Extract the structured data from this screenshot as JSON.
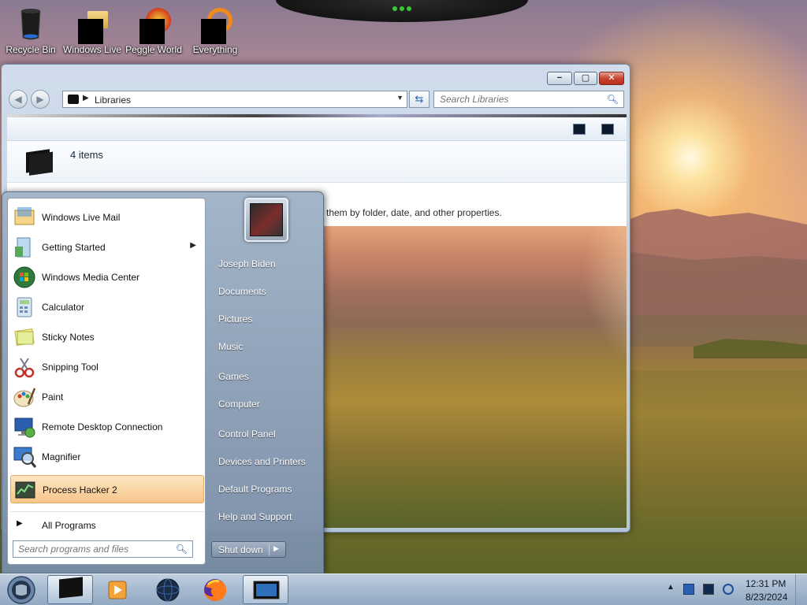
{
  "desktop": {
    "icons": [
      {
        "label": "Recycle Bin"
      },
      {
        "label": "Windows Live Mail"
      },
      {
        "label": "Peggle World of Warcraft"
      },
      {
        "label": "Everything"
      }
    ]
  },
  "explorer": {
    "address_path": "Libraries",
    "search_placeholder": "Search Libraries",
    "items_count": "4 items",
    "description": "them by folder, date, and other properties.",
    "buttons": {
      "minimize": "−",
      "maximize": "▢",
      "close": "✕"
    }
  },
  "start_menu": {
    "programs": [
      {
        "label": "Windows Live Mail",
        "icon": "mail-icon"
      },
      {
        "label": "Getting Started",
        "icon": "getting-started-icon",
        "submenu": true
      },
      {
        "label": "Windows Media Center",
        "icon": "media-center-icon"
      },
      {
        "label": "Calculator",
        "icon": "calculator-icon"
      },
      {
        "label": "Sticky Notes",
        "icon": "sticky-notes-icon"
      },
      {
        "label": "Snipping Tool",
        "icon": "snipping-tool-icon"
      },
      {
        "label": "Paint",
        "icon": "paint-icon"
      },
      {
        "label": "Remote Desktop Connection",
        "icon": "remote-desktop-icon"
      },
      {
        "label": "Magnifier",
        "icon": "magnifier-icon"
      },
      {
        "label": "Process Hacker 2",
        "icon": "process-hacker-icon",
        "highlighted": true
      }
    ],
    "all_programs": "All Programs",
    "search_placeholder": "Search programs and files",
    "right_items": [
      {
        "label": "Joseph Biden"
      },
      {
        "label": "Documents"
      },
      {
        "label": "Pictures"
      },
      {
        "label": "Music"
      },
      {
        "label": "Games"
      },
      {
        "label": "Computer"
      },
      {
        "label": "Control Panel"
      },
      {
        "label": "Devices and Printers"
      },
      {
        "label": "Default Programs"
      },
      {
        "label": "Help and Support"
      }
    ],
    "shutdown_label": "Shut down"
  },
  "taskbar": {
    "buttons": [
      {
        "icon": "libraries-icon",
        "active": true
      },
      {
        "icon": "media-player-icon"
      },
      {
        "icon": "globe-icon"
      },
      {
        "icon": "firefox-icon"
      },
      {
        "icon": "monitor-icon",
        "active": true
      }
    ],
    "clock": {
      "time": "12:31 PM",
      "date": "8/23/2024"
    }
  },
  "colors": {
    "highlight": "#f6c58a",
    "start_menu_blue": "#8ea2ba",
    "taskbar_blue": "#a8bbd0"
  }
}
